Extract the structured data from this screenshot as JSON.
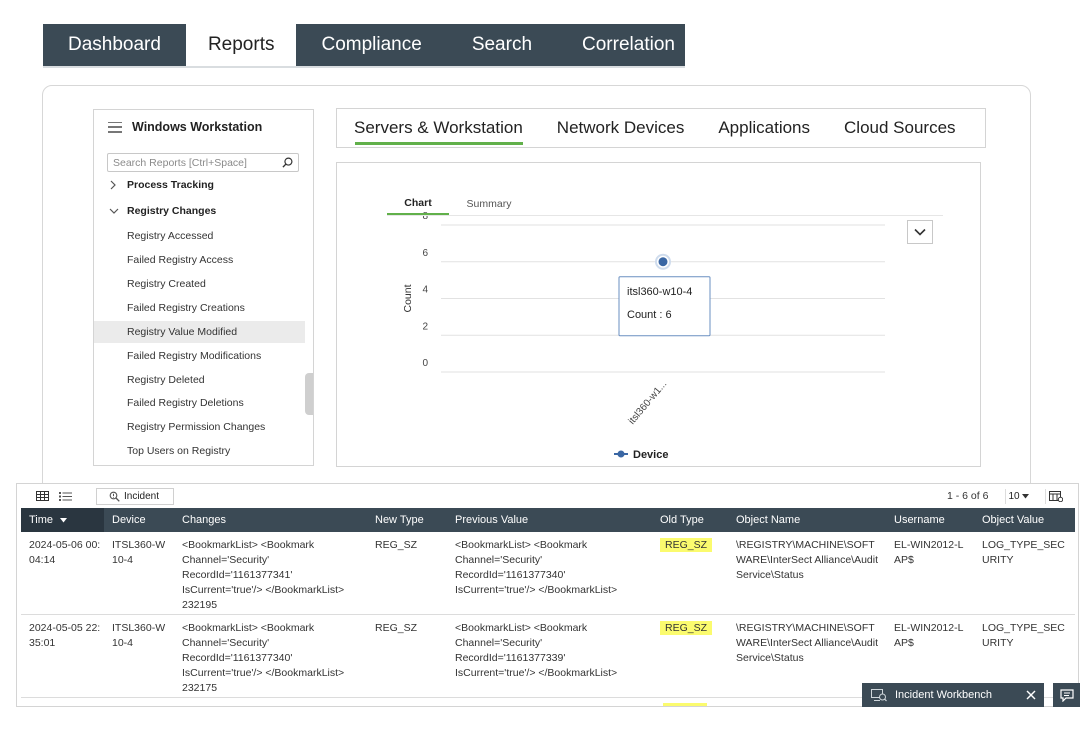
{
  "topnav": {
    "tabs": [
      {
        "label": "Dashboard"
      },
      {
        "label": "Reports"
      },
      {
        "label": "Compliance"
      },
      {
        "label": "Search"
      },
      {
        "label": "Correlation"
      }
    ],
    "active": "Reports"
  },
  "sidebar": {
    "title": "Windows Workstation",
    "search_placeholder": "Search Reports [Ctrl+Space]",
    "groups": [
      {
        "label": "Process Tracking",
        "expanded": false
      },
      {
        "label": "Registry Changes",
        "expanded": true
      }
    ],
    "items": [
      "Registry Accessed",
      "Failed Registry Access",
      "Registry Created",
      "Failed Registry Creations",
      "Registry Value Modified",
      "Failed Registry Modifications",
      "Registry Deleted",
      "Failed Registry Deletions",
      "Registry Permission Changes",
      "Top Users on Registry"
    ],
    "active_item": "Registry Value Modified",
    "icons": {
      "menu": "hamburger-menu-icon",
      "search": "search-icon",
      "collapsed": "chevron-right-icon",
      "expanded": "chevron-down-icon"
    }
  },
  "category_tabs": {
    "tabs": [
      {
        "label": "Servers & Workstation"
      },
      {
        "label": "Network Devices"
      },
      {
        "label": "Applications"
      },
      {
        "label": "Cloud Sources"
      }
    ],
    "active": "Servers & Workstation",
    "accent": "#61b04a"
  },
  "chart_panel": {
    "subtabs": {
      "chart": "Chart",
      "summary": "Summary"
    },
    "tooltip": {
      "device": "itsl360-w10-4",
      "count_text": "Count : 6"
    }
  },
  "chart_data": {
    "type": "scatter",
    "ylabel": "Count",
    "ylim": [
      0,
      8
    ],
    "yticks": [
      0,
      2,
      4,
      6,
      8
    ],
    "categories": [
      "itsl360-w1..."
    ],
    "series": [
      {
        "name": "Device",
        "values": [
          6
        ]
      }
    ],
    "legend": "bottom-center",
    "color": "#3a67a4",
    "grid": true
  },
  "table": {
    "view_icons": {
      "grid": "grid-view-icon",
      "list": "list-view-icon"
    },
    "incident_label": "Incident",
    "pager": "1 - 6 of 6",
    "page_size": "10",
    "columns": [
      "Time",
      "Device",
      "Changes",
      "New Type",
      "Previous Value",
      "Old Type",
      "Object Name",
      "Username",
      "Object Value"
    ],
    "rows": [
      {
        "time": "2024-05-06 00:04:14",
        "device": "ITSL360-W10-4",
        "changes": "<BookmarkList> <Bookmark Channel='Security' RecordId='1161377341' IsCurrent='true'/> </BookmarkList> 232195",
        "new_type": "REG_SZ",
        "previous_value": "<BookmarkList> <Bookmark Channel='Security' RecordId='1161377340' IsCurrent='true'/> </BookmarkList>",
        "old_type": "REG_SZ",
        "object_name": "\\REGISTRY\\MACHINE\\SOFTWARE\\InterSect Alliance\\AuditService\\Status",
        "username": "EL-WIN2012-LAP$",
        "object_value": "LOG_TYPE_SECURITY"
      },
      {
        "time": "2024-05-05 22:35:01",
        "device": "ITSL360-W10-4",
        "changes": "<BookmarkList> <Bookmark Channel='Security' RecordId='1161377340' IsCurrent='true'/> </BookmarkList> 232175",
        "new_type": "REG_SZ",
        "previous_value": "<BookmarkList> <Bookmark Channel='Security' RecordId='1161377339' IsCurrent='true'/> </BookmarkList>",
        "old_type": "REG_SZ",
        "object_name": "\\REGISTRY\\MACHINE\\SOFTWARE\\InterSect Alliance\\AuditService\\Status",
        "username": "EL-WIN2012-LAP$",
        "object_value": "LOG_TYPE_SECURITY"
      }
    ],
    "highlight_color": "#fbfb6e"
  },
  "incident_workbench": {
    "label": "Incident Workbench",
    "icons": {
      "workbench": "workbench-icon",
      "close": "close-icon",
      "chat": "chat-icon"
    }
  }
}
